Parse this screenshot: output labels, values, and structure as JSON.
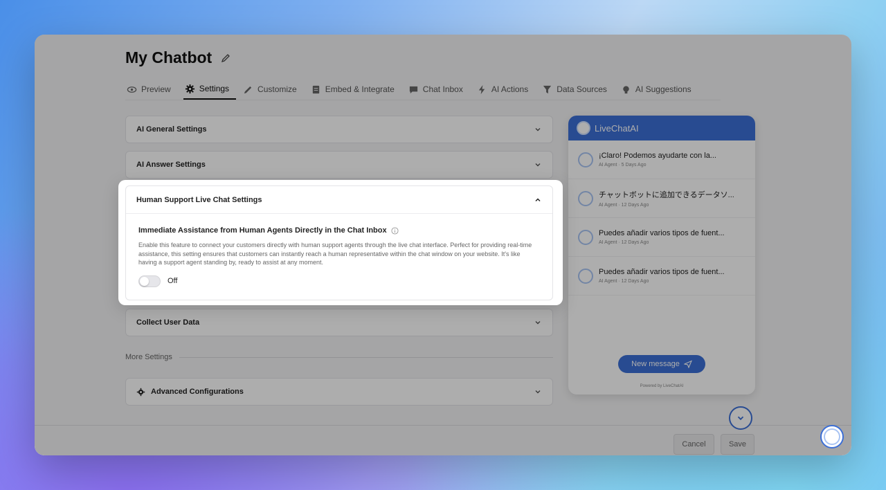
{
  "page": {
    "title": "My Chatbot"
  },
  "tabs": [
    {
      "label": "Preview",
      "icon": "eye-icon"
    },
    {
      "label": "Settings",
      "icon": "gear-icon",
      "active": true
    },
    {
      "label": "Customize",
      "icon": "pencil-icon"
    },
    {
      "label": "Embed & Integrate",
      "icon": "document-icon"
    },
    {
      "label": "Chat Inbox",
      "icon": "chat-icon"
    },
    {
      "label": "AI Actions",
      "icon": "lightning-icon"
    },
    {
      "label": "Data Sources",
      "icon": "filter-icon"
    },
    {
      "label": "AI Suggestions",
      "icon": "lightbulb-icon"
    }
  ],
  "accordions": {
    "general": "AI General Settings",
    "answer": "AI Answer Settings",
    "human_support": "Human Support Live Chat Settings",
    "collect": "Collect User Data",
    "advanced": "Advanced Configurations"
  },
  "human_support": {
    "feature_title": "Immediate Assistance from Human Agents Directly in the Chat Inbox",
    "description": "Enable this feature to connect your customers directly with human support agents through the live chat interface. Perfect for providing real-time assistance, this setting ensures that customers can instantly reach a human representative within the chat window on your website. It's like having a support agent standing by, ready to assist at any moment.",
    "toggle_label": "Off",
    "toggle_on": false
  },
  "more_settings_label": "More Settings",
  "footer": {
    "cancel": "Cancel",
    "save": "Save"
  },
  "preview": {
    "brand": "LiveChatAI",
    "messages": [
      {
        "text": "¡Claro! Podemos ayudarte con la...",
        "meta": "AI Agent · 5 Days Ago"
      },
      {
        "text": "チャットボットに追加できるデータソ...",
        "meta": "AI Agent · 12 Days Ago"
      },
      {
        "text": "Puedes añadir varios tipos de fuent...",
        "meta": "AI Agent · 12 Days Ago"
      },
      {
        "text": "Puedes añadir varios tipos de fuent...",
        "meta": "AI Agent · 12 Days Ago"
      }
    ],
    "new_message": "New message",
    "powered_by": "Powered by LiveChatAI"
  },
  "colors": {
    "accent": "#3c6fd6",
    "text": "#222222"
  }
}
